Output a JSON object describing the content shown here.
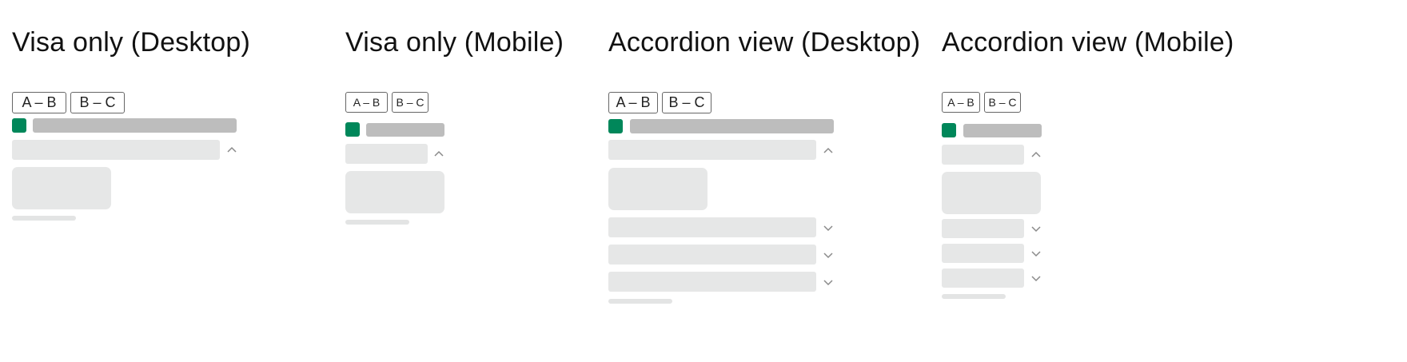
{
  "panels": [
    {
      "title": "Visa only (Desktop)",
      "tabs": [
        "A – B",
        "B – C"
      ],
      "accordion_items": 1,
      "expanded_item": 1
    },
    {
      "title": "Visa only (Mobile)",
      "tabs": [
        "A – B",
        "B – C"
      ],
      "accordion_items": 1,
      "expanded_item": 1
    },
    {
      "title": "Accordion view (Desktop)",
      "tabs": [
        "A – B",
        "B – C"
      ],
      "accordion_items": 4,
      "expanded_item": 1
    },
    {
      "title": "Accordion view (Mobile)",
      "tabs": [
        "A – B",
        "B – C"
      ],
      "accordion_items": 4,
      "expanded_item": 1
    }
  ],
  "icons": {
    "expanded": "chevron-up-icon",
    "collapsed": "chevron-down-icon",
    "flag": "square-flag-icon"
  },
  "colors": {
    "accent": "#00875a",
    "skeleton_dark": "#bdbdbd",
    "skeleton_light": "#e6e7e7",
    "tab_border": "#666666"
  }
}
